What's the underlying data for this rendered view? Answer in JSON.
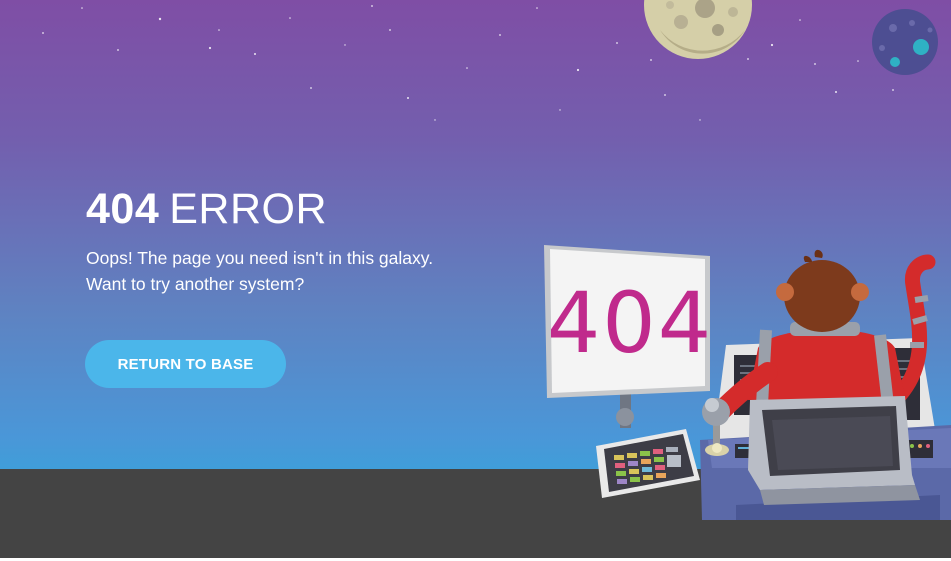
{
  "error": {
    "code": "404",
    "word": "ERROR"
  },
  "message": {
    "line1": "Oops! The page you need isn't in this galaxy.",
    "line2": "Want to try another system?"
  },
  "button": {
    "label": "RETURN TO BASE"
  },
  "monitor": {
    "text": "404"
  },
  "colors": {
    "sky_top": "#7f4ea5",
    "sky_bottom": "#3f9ed9",
    "floor": "#444444",
    "button": "#4bb6ea",
    "monitor_text": "#c02a8c",
    "suit": "#d42b2b"
  }
}
